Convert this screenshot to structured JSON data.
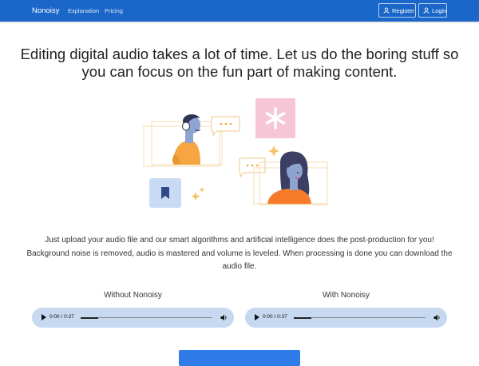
{
  "nav": {
    "brand": "Nonoisy",
    "links": [
      "Explanation",
      "Pricing"
    ],
    "register_label": "Register",
    "login_label": "Login"
  },
  "hero": {
    "headline": "Editing digital audio takes a lot of time. Let us do the boring stuff so you can focus on the fun part of making content.",
    "description": "Just upload your audio file and our smart algorithms and artificial intelligence does the post-production for you! Background noise is removed, audio is mastered and volume is leveled. When processing is done you can download the audio file."
  },
  "comparison": [
    {
      "label": "Without Nonoisy",
      "time": "0:00 / 0:37",
      "progress": 0.0
    },
    {
      "label": "With Nonoisy",
      "time": "0:00 / 0:37",
      "progress": 0.0
    }
  ],
  "icons": {
    "register": "user-icon",
    "login": "user-icon",
    "player_play": "play-icon",
    "player_volume": "volume-icon"
  },
  "colors": {
    "navbar": "#1a66c9",
    "player_bg": "#c6d9f1",
    "cta": "#2f7be8",
    "illus_pink": "#f7c6d6",
    "illus_blue": "#c9dbf4",
    "illus_orange": "#f5a640"
  }
}
